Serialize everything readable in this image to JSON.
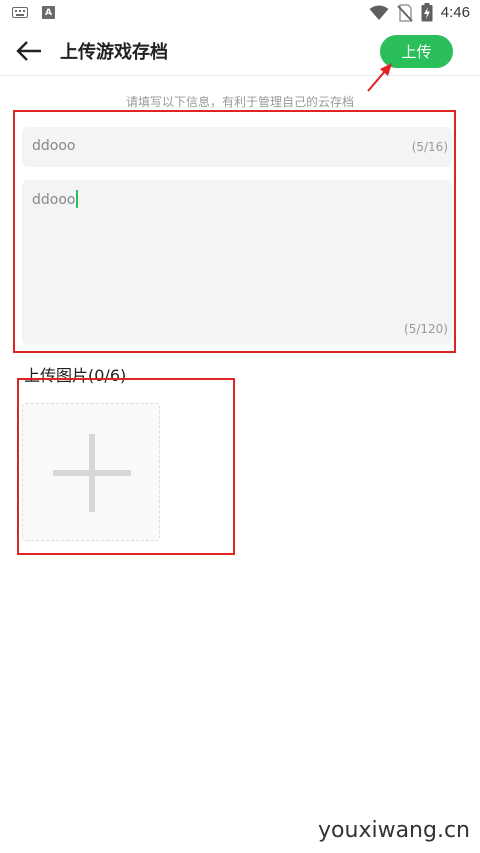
{
  "status_bar": {
    "time": "4:46",
    "left_icons": [
      "keyboard-icon",
      "a-icon"
    ],
    "a_icon_label": "A",
    "right_icons": [
      "wifi-icon",
      "no-sim-icon",
      "battery-charging-icon"
    ]
  },
  "header": {
    "title": "上传游戏存档",
    "upload_label": "上传",
    "back_icon": "arrow-left-icon"
  },
  "form": {
    "hint": "请填写以下信息，有利于管理自己的云存档",
    "title_value": "ddooo",
    "title_count": "(5/16)",
    "description_value": "ddooo",
    "description_count": "(5/120)"
  },
  "images": {
    "label": "上传图片(0/6)",
    "add_icon": "plus-icon"
  },
  "watermark": "youxiwang.cn",
  "colors": {
    "accent": "#2bbf5c",
    "annotation": "#e02323",
    "field_bg": "#f4f4f4"
  }
}
